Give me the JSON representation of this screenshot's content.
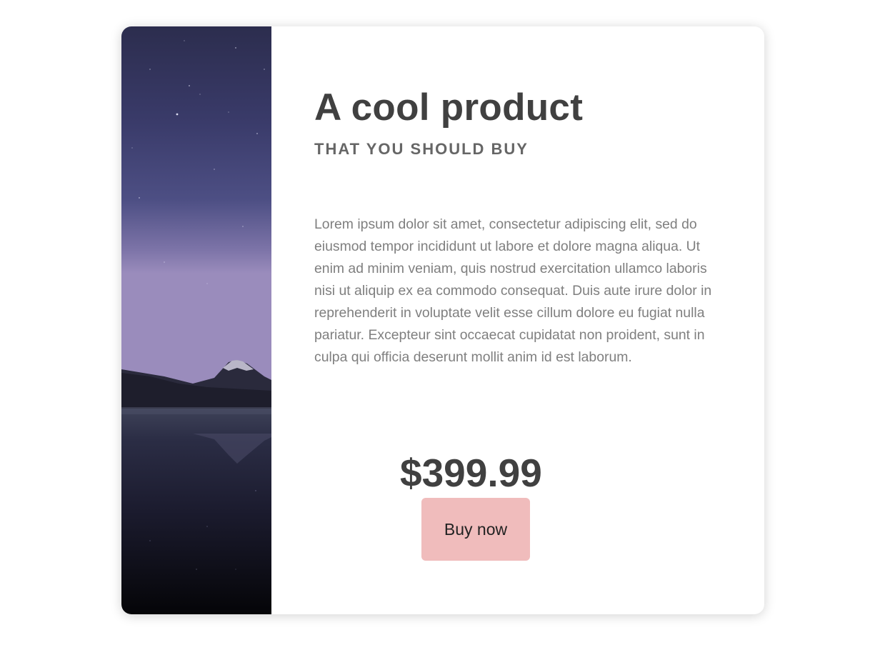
{
  "product": {
    "title": "A cool product",
    "subtitle": "THAT YOU SHOULD BUY",
    "description": "Lorem ipsum dolor sit amet, consectetur adipiscing elit, sed do eiusmod tempor incididunt ut labore et dolore magna aliqua. Ut enim ad minim veniam, quis nostrud exercitation ullamco laboris nisi ut aliquip ex ea commodo consequat. Duis aute irure dolor in reprehenderit in voluptate velit esse cillum dolore eu fugiat nulla pariatur. Excepteur sint occaecat cupidatat non proident, sunt in culpa qui officia deserunt mollit anim id est laborum.",
    "price": "$399.99",
    "buy_label": "Buy now"
  },
  "colors": {
    "title": "#404040",
    "subtitle": "#666666",
    "body_text": "#7f7f7f",
    "button_bg": "#f0bcbc"
  },
  "image": {
    "subject": "night-sky-mountain-lake-photo"
  }
}
